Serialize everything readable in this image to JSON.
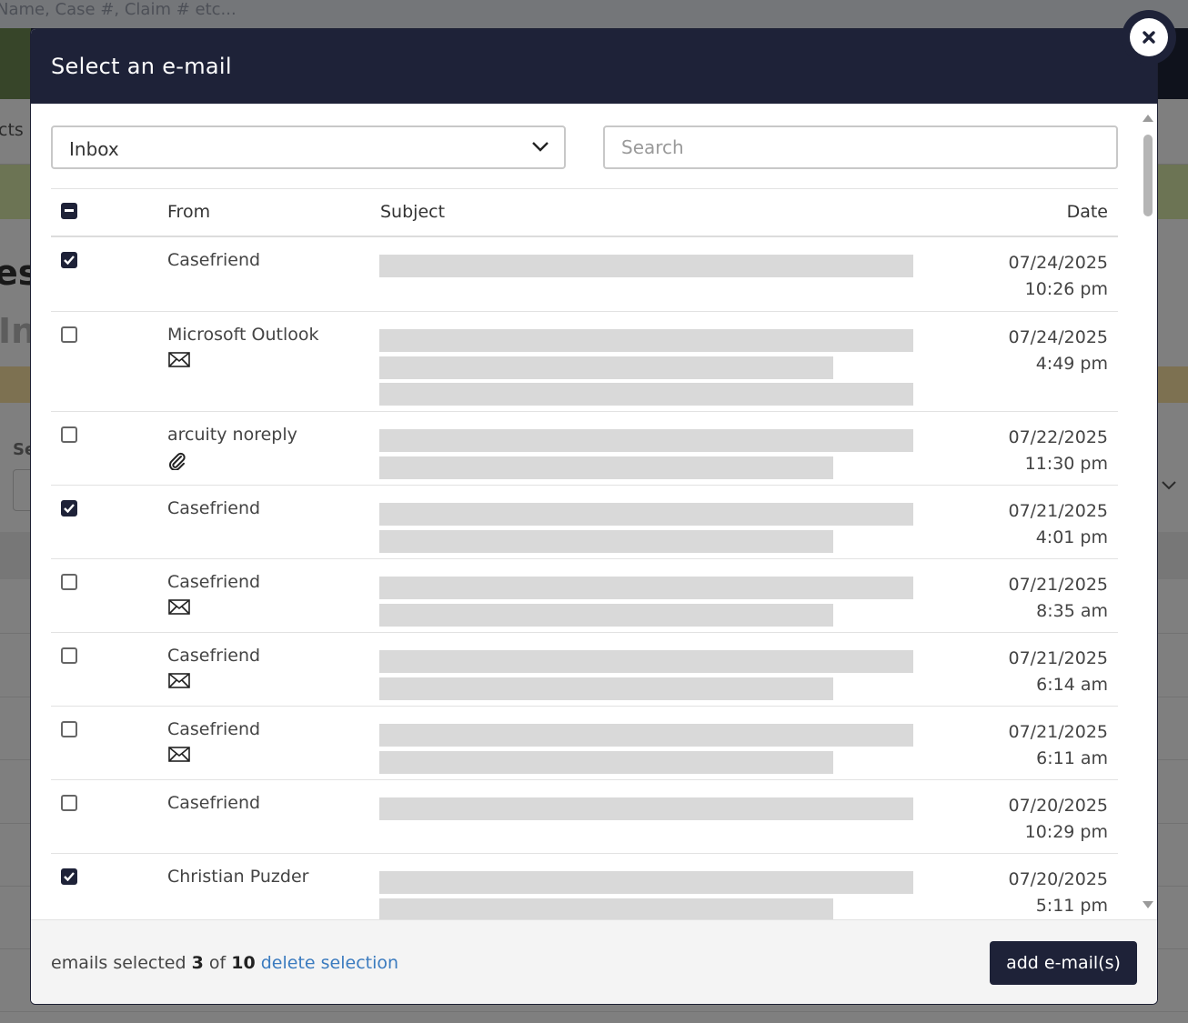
{
  "background": {
    "search_placeholder": "Name, Case #, Claim # etc...",
    "nav_text": "cts",
    "title1": "es",
    "title2": "In",
    "label_se": "Se"
  },
  "modal": {
    "title": "Select an e-mail",
    "close_icon": "close-icon",
    "folder_select": {
      "value": "Inbox",
      "options_visible": [
        "Inbox"
      ]
    },
    "search": {
      "placeholder": "Search",
      "value": ""
    },
    "columns": {
      "from": "From",
      "subject": "Subject",
      "date": "Date"
    },
    "rows": [
      {
        "checked": true,
        "from": "Casefriend",
        "icon": "",
        "subject_lines": 1,
        "date": "07/24/2025",
        "time": "10:26 pm"
      },
      {
        "checked": false,
        "from": "Microsoft Outlook",
        "icon": "envelope-icon",
        "subject_lines": 3,
        "date": "07/24/2025",
        "time": "4:49 pm"
      },
      {
        "checked": false,
        "from": "arcuity noreply",
        "icon": "paperclip-icon",
        "subject_lines": 2,
        "date": "07/22/2025",
        "time": "11:30 pm"
      },
      {
        "checked": true,
        "from": "Casefriend",
        "icon": "",
        "subject_lines": 2,
        "date": "07/21/2025",
        "time": "4:01 pm"
      },
      {
        "checked": false,
        "from": "Casefriend",
        "icon": "envelope-icon",
        "subject_lines": 2,
        "date": "07/21/2025",
        "time": "8:35 am"
      },
      {
        "checked": false,
        "from": "Casefriend",
        "icon": "envelope-icon",
        "subject_lines": 2,
        "date": "07/21/2025",
        "time": "6:14 am"
      },
      {
        "checked": false,
        "from": "Casefriend",
        "icon": "envelope-icon",
        "subject_lines": 2,
        "date": "07/21/2025",
        "time": "6:11 am"
      },
      {
        "checked": false,
        "from": "Casefriend",
        "icon": "",
        "subject_lines": 1,
        "date": "07/20/2025",
        "time": "10:29 pm"
      },
      {
        "checked": true,
        "from": "Christian Puzder",
        "icon": "",
        "subject_lines": 2,
        "date": "07/20/2025",
        "time": "5:11 pm"
      }
    ],
    "footer": {
      "selected_prefix": "emails selected",
      "selected_count": "3",
      "of_word": "of",
      "total_count": "10",
      "delete_label": "delete selection",
      "add_label": "add e-mail(s)"
    },
    "colors": {
      "header_bg": "#1e2238",
      "link": "#3b7bbf",
      "redacted": "#d9d9d9"
    }
  }
}
